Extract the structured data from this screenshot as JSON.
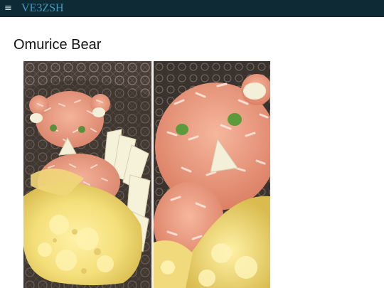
{
  "header": {
    "menu_icon": "hamburger-menu-icon",
    "menu_glyph": "≡",
    "site_title": "VE3ZSH"
  },
  "article": {
    "title": "Omurice Bear",
    "images": [
      {
        "name": "omurice-bear-photo-1",
        "subject": "omurice-bear"
      },
      {
        "name": "omurice-bear-photo-2",
        "subject": "omurice-bear-closeup"
      }
    ]
  },
  "colors": {
    "header_bg": "#0e2a35",
    "site_title": "#3d9cc6",
    "page_title": "#111111",
    "page_bg": "#ffffff"
  }
}
